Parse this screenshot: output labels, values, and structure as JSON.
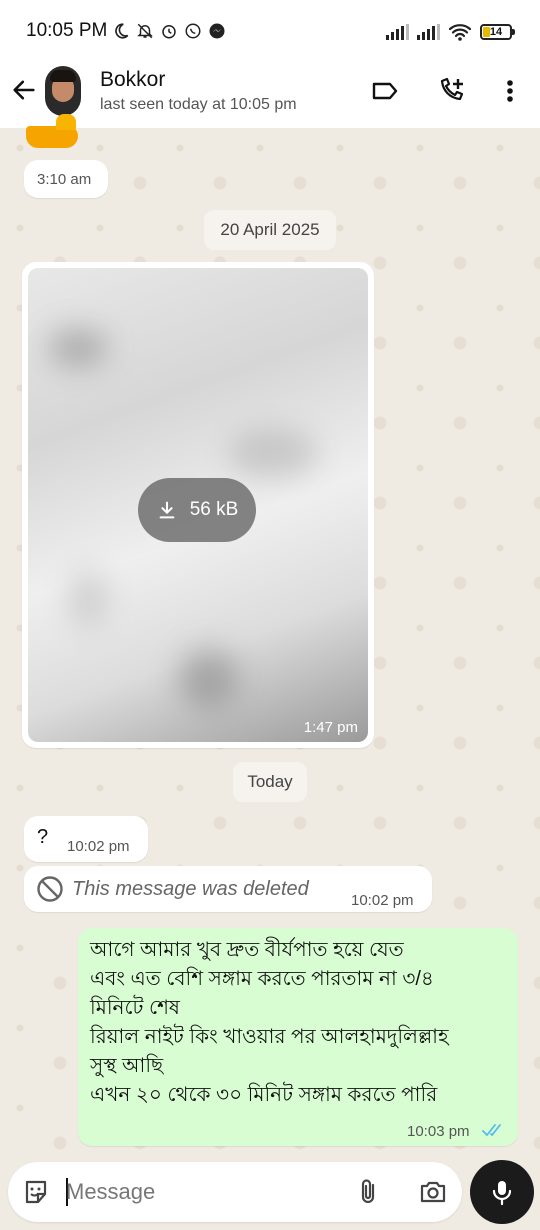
{
  "status_bar": {
    "time": "10:05 PM",
    "battery_level": "14",
    "icons_left": [
      "moon-icon",
      "bell-off-icon",
      "alarm-icon",
      "whatsapp-icon",
      "messenger-icon"
    ],
    "icons_right": [
      "signal-icon",
      "signal-icon",
      "wifi-icon",
      "battery-icon"
    ]
  },
  "header": {
    "contact_name": "Bokkor",
    "last_seen": "last seen today at 10:05 pm",
    "icons": [
      "back-arrow-icon",
      "label-icon",
      "add-call-icon",
      "more-vert-icon"
    ]
  },
  "messages": [
    {
      "type": "incoming",
      "time": "3:10 am",
      "content": "thumbs-up-emoji"
    },
    {
      "type": "date",
      "label": "20 April 2025"
    },
    {
      "type": "incoming_media",
      "size": "56 kB",
      "time": "1:47 pm"
    },
    {
      "type": "date",
      "label": "Today"
    },
    {
      "type": "incoming",
      "text": "?",
      "time": "10:02 pm"
    },
    {
      "type": "incoming_deleted",
      "text": "This message was deleted",
      "time": "10:02 pm"
    },
    {
      "type": "outgoing",
      "lines": [
        "আগে আমার খুব দ্রুত বীর্যপাত হয়ে যেত",
        "এবং এত বেশি সঙ্গাম করতে পারতাম না ৩/৪",
        "মিনিটে শেষ",
        "রিয়াল নাইট কিং খাওয়ার পর আলহামদুলিল্লাহ",
        "সুস্থ আছি",
        "এখন ২০ থেকে ৩০ মিনিট সঙ্গাম করতে পারি"
      ],
      "time": "10:03 pm",
      "status": "read"
    }
  ],
  "input_bar": {
    "placeholder": "Message",
    "icons": [
      "sticker-icon",
      "attach-icon",
      "camera-icon",
      "mic-icon"
    ]
  },
  "colors": {
    "chat_bg": "#efeae2",
    "outgoing_bubble": "#d9fdd3",
    "incoming_bubble": "#ffffff",
    "read_ticks": "#53bdeb"
  }
}
